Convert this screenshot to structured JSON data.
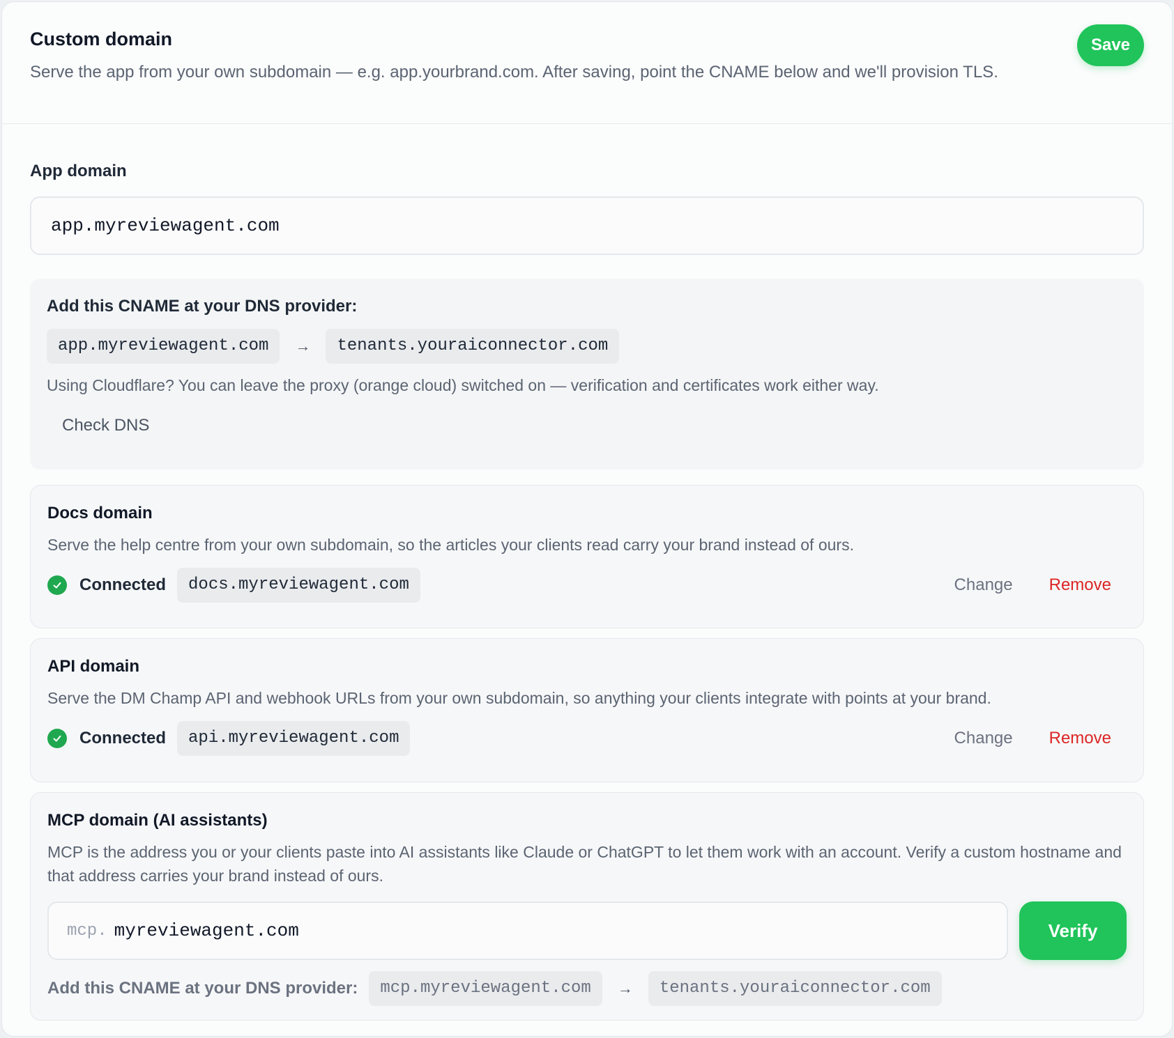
{
  "header": {
    "title": "Custom domain",
    "subtitle": "Serve the app from your own subdomain — e.g. app.yourbrand.com. After saving, point the CNAME below and we'll provision TLS.",
    "save_label": "Save"
  },
  "app_domain": {
    "label": "App domain",
    "value": "app.myreviewagent.com",
    "dns": {
      "title": "Add this CNAME at your DNS provider:",
      "host": "app.myreviewagent.com",
      "arrow": "→",
      "target": "tenants.youraiconnector.com",
      "note": "Using Cloudflare? You can leave the proxy (orange cloud) switched on — verification and certificates work either way.",
      "check_label": "Check DNS"
    }
  },
  "docs_domain": {
    "title": "Docs domain",
    "description": "Serve the help centre from your own subdomain, so the articles your clients read carry your brand instead of ours.",
    "status": "Connected",
    "domain": "docs.myreviewagent.com",
    "change_label": "Change",
    "remove_label": "Remove"
  },
  "api_domain": {
    "title": "API domain",
    "description": "Serve the DM Champ API and webhook URLs from your own subdomain, so anything your clients integrate with points at your brand.",
    "status": "Connected",
    "domain": "api.myreviewagent.com",
    "change_label": "Change",
    "remove_label": "Remove"
  },
  "mcp_domain": {
    "title": "MCP domain (AI assistants)",
    "description": "MCP is the address you or your clients paste into AI assistants like Claude or ChatGPT to let them work with an account. Verify a custom hostname and that address carries your brand instead of ours.",
    "prefix": "mcp.",
    "value": "myreviewagent.com",
    "verify_label": "Verify",
    "dns_title": "Add this CNAME at your DNS provider:",
    "host": "mcp.myreviewagent.com",
    "arrow": "→",
    "target": "tenants.youraiconnector.com"
  },
  "colors": {
    "accent": "#20c45a",
    "success": "#1fa84f",
    "danger": "#dc2626"
  }
}
